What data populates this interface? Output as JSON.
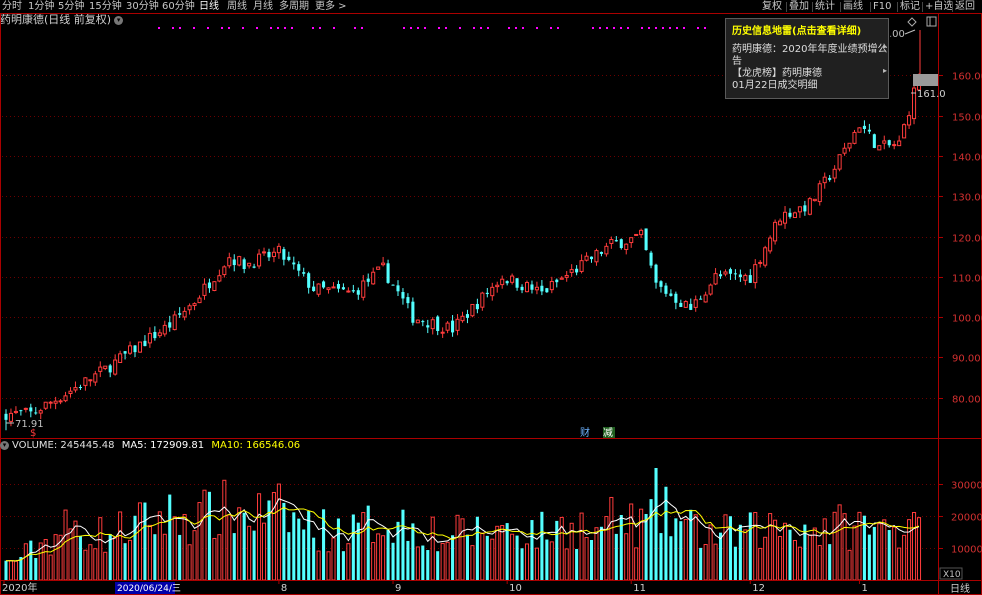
{
  "toolbar": {
    "left": [
      "分时",
      "1分钟",
      "5分钟",
      "15分钟",
      "30分钟",
      "60分钟",
      "日线",
      "周线",
      "月线",
      "多周期",
      "更多 >"
    ],
    "active": "日线",
    "right": [
      "复权",
      "叠加",
      "统计",
      "画线",
      "F10",
      "标记",
      "+自选",
      "返回"
    ]
  },
  "header": {
    "stock_title": "药明康德(日线 前复权)",
    "dropdown_glyph": "▾"
  },
  "popup": {
    "title": "历史信息地雷(点击查看详细)",
    "line1": "药明康德：2020年年度业绩预增公",
    "line2": "告",
    "line3": "【龙虎榜】药明康德",
    "line4": "01月22日成交明细",
    "arrow": "▸"
  },
  "volume_legend": {
    "volume_label": "VOLUME: 245445.48",
    "ma5_label": "MA5: 172909.81",
    "ma10_label": "MA10: 166546.06"
  },
  "price_labels": {
    "low_marker": "71.91",
    "last_price_left": "161.0",
    "partial_top": ".00"
  },
  "event_markers": {
    "cai": "财",
    "jian": "减",
    "dollar": "$"
  },
  "bottom": {
    "year_label": "2020年",
    "cursor_date": "2020/06/24/三",
    "period_label": "日线",
    "scale_label": "X10"
  },
  "colors": {
    "up": "#ff3c3c",
    "down": "#54ffff",
    "ma5": "#ffffff",
    "ma10": "#ffff00",
    "axis": "#aa0000",
    "grid": "#6a0000",
    "event": "#ff00ff"
  },
  "chart_data": {
    "type": "candlestick",
    "price_axis": {
      "ticks": [
        80,
        90,
        100,
        110,
        120,
        130,
        140,
        150,
        160
      ],
      "range": [
        70,
        175
      ]
    },
    "volume_axis": {
      "ticks": [
        10000,
        20000,
        30000
      ],
      "range": [
        0,
        40000
      ]
    },
    "x_ticks": [
      "2020年",
      "8",
      "9",
      "10",
      "11",
      "12",
      "1"
    ],
    "knots": [
      [
        0,
        76,
        5000
      ],
      [
        5,
        76,
        9000
      ],
      [
        12,
        81,
        16000
      ],
      [
        20,
        87,
        14000
      ],
      [
        28,
        94,
        18000
      ],
      [
        33,
        98,
        20000
      ],
      [
        38,
        104,
        19000
      ],
      [
        45,
        115,
        22000
      ],
      [
        48,
        113,
        20000
      ],
      [
        55,
        116,
        21000
      ],
      [
        62,
        107,
        16000
      ],
      [
        70,
        106,
        15000
      ],
      [
        76,
        112,
        19000
      ],
      [
        82,
        100,
        17000
      ],
      [
        90,
        97,
        14000
      ],
      [
        100,
        110,
        16000
      ],
      [
        108,
        106,
        15000
      ],
      [
        115,
        112,
        17000
      ],
      [
        122,
        118,
        18000
      ],
      [
        128,
        120,
        17000
      ],
      [
        131,
        108,
        22000
      ],
      [
        138,
        102,
        16000
      ],
      [
        143,
        110,
        14000
      ],
      [
        150,
        110,
        15000
      ],
      [
        156,
        125,
        17000
      ],
      [
        162,
        128,
        16000
      ],
      [
        167,
        137,
        16500
      ],
      [
        172,
        148,
        17000
      ],
      [
        176,
        142,
        15000
      ],
      [
        180,
        143,
        17000
      ],
      [
        184,
        160,
        24000
      ]
    ],
    "spikes": [
      [
        131,
        35000
      ],
      [
        118,
        12500
      ],
      [
        87,
        9000
      ]
    ],
    "ma_volume": {
      "ma5_scale": 1.0,
      "ma10_scale": 1.0
    },
    "candle_count": 185
  }
}
